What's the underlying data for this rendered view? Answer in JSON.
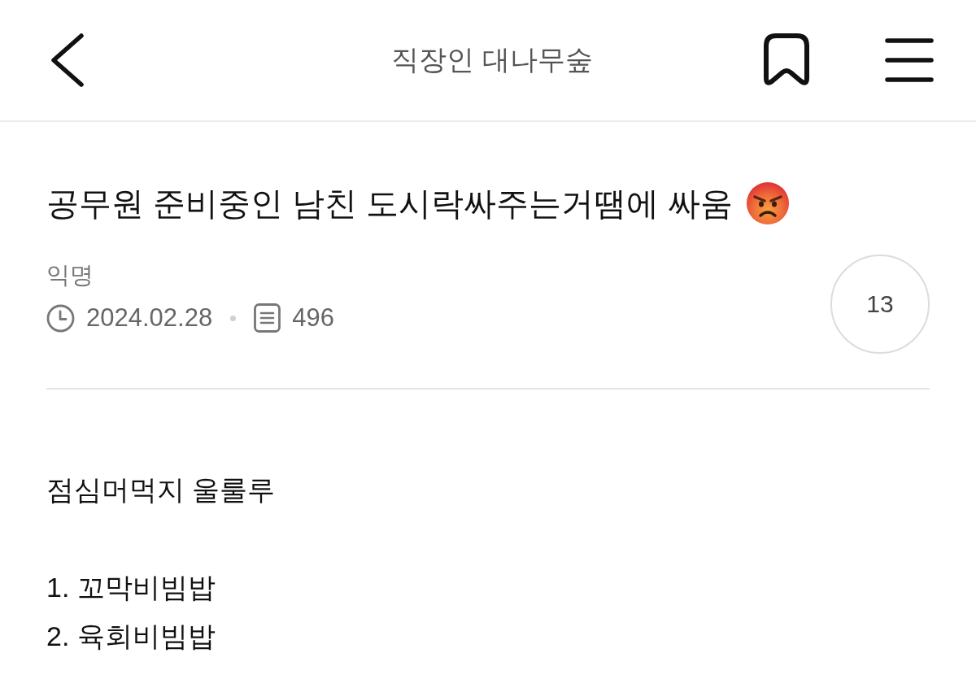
{
  "header": {
    "title": "직장인 대나무숲"
  },
  "post": {
    "title": "공무원 준비중인 남친 도시락싸주는거땜에 싸움",
    "author": "익명",
    "date": "2024.02.28",
    "views": "496",
    "count": "13",
    "body": [
      {
        "lines": [
          "점심머먹지 울룰루"
        ]
      },
      {
        "lines": [
          "1. 꼬막비빔밥",
          "2. 육회비빔밥"
        ]
      }
    ]
  }
}
